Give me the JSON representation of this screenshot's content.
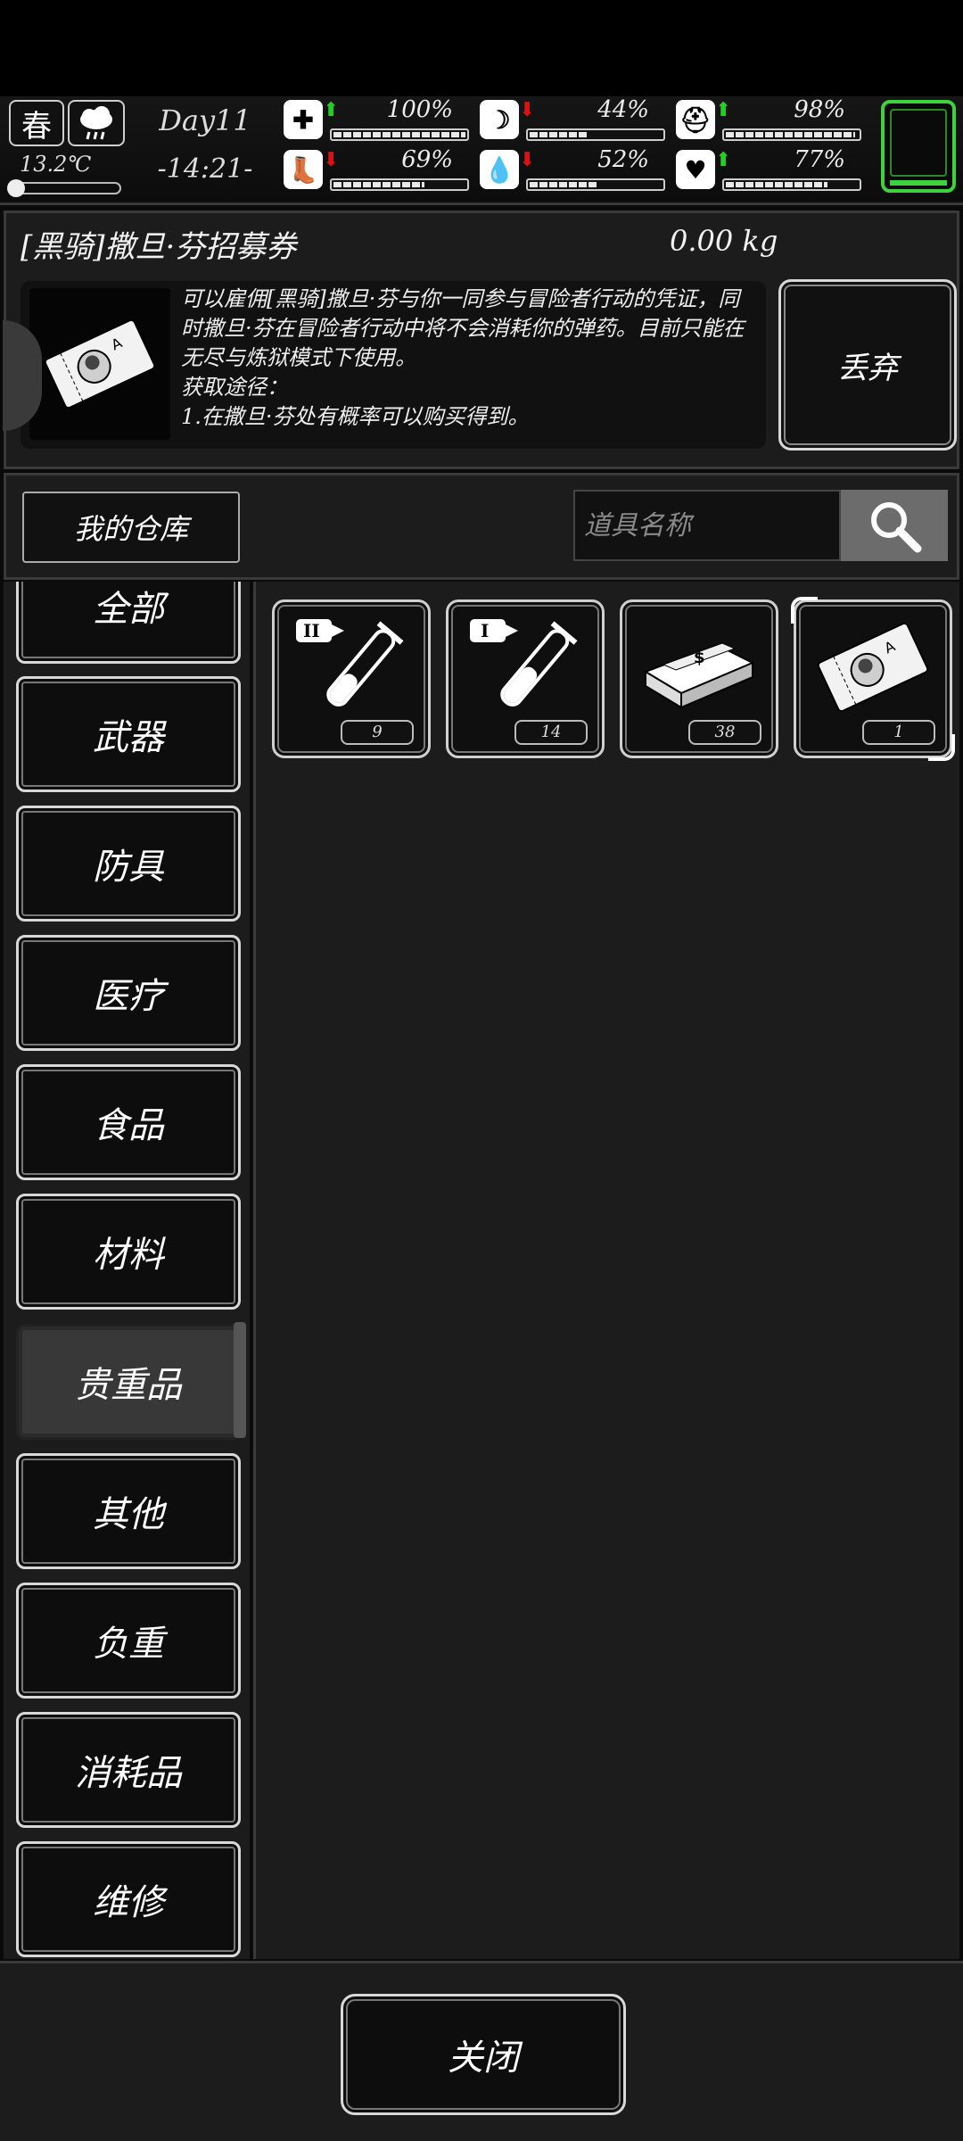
{
  "hud": {
    "season": "春",
    "temperature": "13.2℃",
    "day": "Day11",
    "time": "-14:21-",
    "stats": [
      {
        "name": "health",
        "icon": "medkit-icon",
        "trend": "up",
        "percent": "100%",
        "level": 1.0
      },
      {
        "name": "hunger",
        "icon": "stomach-icon",
        "trend": "down",
        "percent": "44%",
        "level": 0.44
      },
      {
        "name": "armor",
        "icon": "helmet-icon",
        "trend": "up",
        "percent": "98%",
        "level": 0.98
      },
      {
        "name": "stamina",
        "icon": "boot-icon",
        "trend": "down",
        "percent": "69%",
        "level": 0.69
      },
      {
        "name": "thirst",
        "icon": "water-drop-icon",
        "trend": "down",
        "percent": "52%",
        "level": 0.52
      },
      {
        "name": "mood",
        "icon": "heart-icon",
        "trend": "up",
        "percent": "77%",
        "level": 0.77
      }
    ]
  },
  "detail": {
    "title": "[黑骑]撒旦·芬招募券",
    "weight": "0.00 kg",
    "description": "可以雇佣[黑骑]撒旦·芬与你一同参与冒险者行动的凭证，同时撒旦·芬在冒险者行动中将不会消耗你的弹药。目前只能在无尽与炼狱模式下使用。\n获取途径：\n1.在撒旦·芬处有概率可以购买得到。",
    "discard_label": "丢弃"
  },
  "warehouse": {
    "button_label": "我的仓库",
    "search_placeholder": "道具名称"
  },
  "categories": [
    {
      "label": "全部",
      "active": false
    },
    {
      "label": "武器",
      "active": false
    },
    {
      "label": "防具",
      "active": false
    },
    {
      "label": "医疗",
      "active": false
    },
    {
      "label": "食品",
      "active": false
    },
    {
      "label": "材料",
      "active": false
    },
    {
      "label": "贵重品",
      "active": true
    },
    {
      "label": "其他",
      "active": false
    },
    {
      "label": "负重",
      "active": false
    },
    {
      "label": "消耗品",
      "active": false
    },
    {
      "label": "维修",
      "active": false
    }
  ],
  "items": [
    {
      "icon": "syringe-ii-icon",
      "count": "9"
    },
    {
      "icon": "syringe-i-icon",
      "count": "14"
    },
    {
      "icon": "cash-bundle-icon",
      "count": "38"
    },
    {
      "icon": "ticket-icon",
      "count": "1",
      "selected": true
    }
  ],
  "close_label": "关闭"
}
